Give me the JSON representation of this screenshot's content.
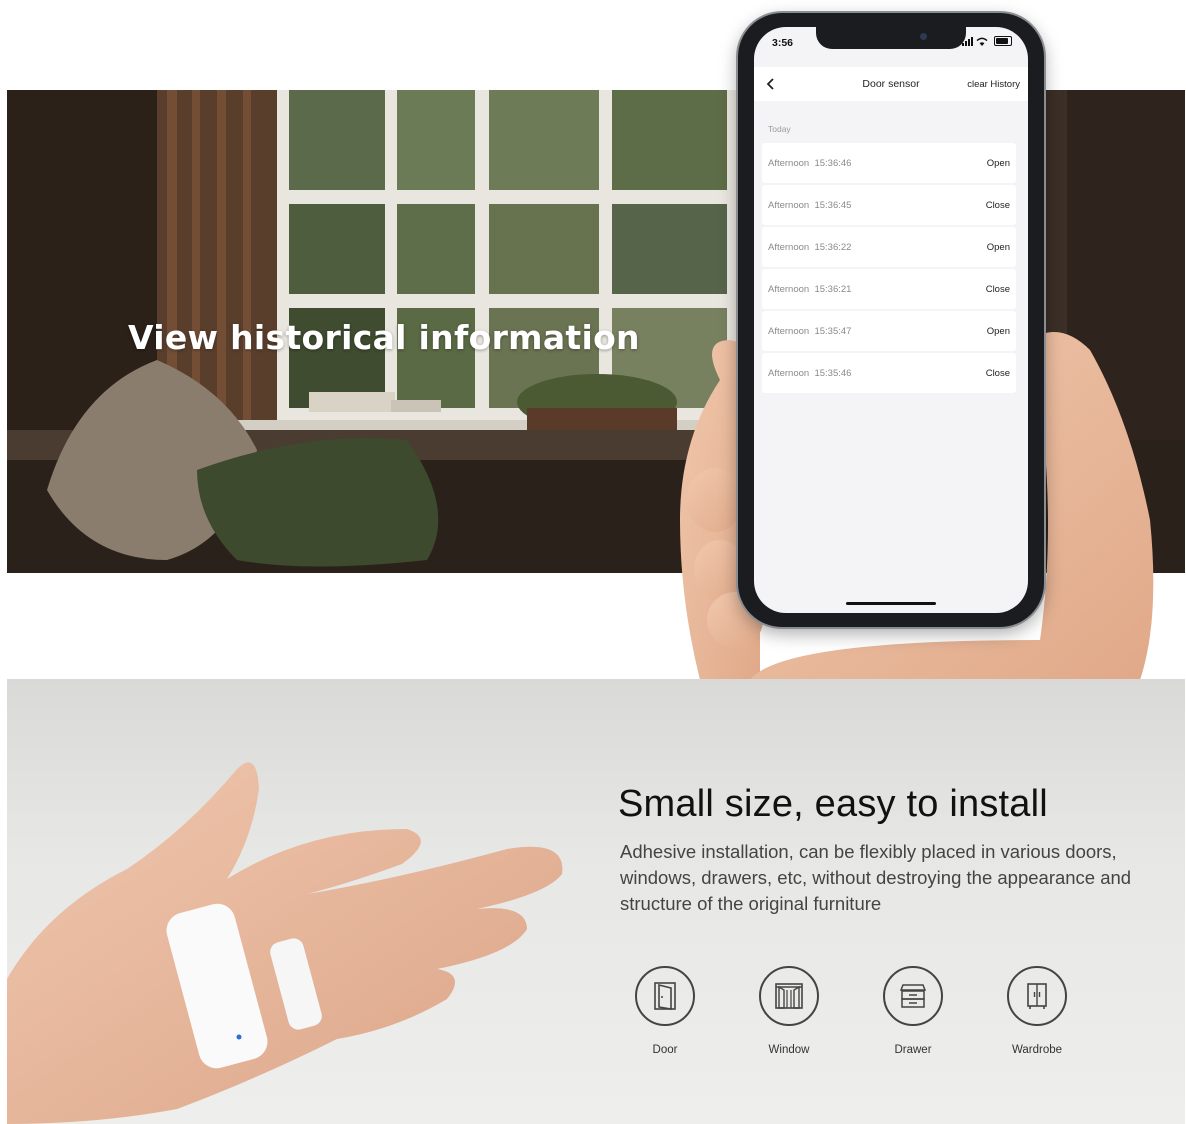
{
  "banner": {
    "title": "View historical information"
  },
  "phone": {
    "status_time": "3:56",
    "nav_title": "Door sensor",
    "nav_action": "clear History",
    "section_label": "Today",
    "history": [
      {
        "time": "Afternoon  15:36:46",
        "state": "Open"
      },
      {
        "time": "Afternoon  15:36:45",
        "state": "Close"
      },
      {
        "time": "Afternoon  15:36:22",
        "state": "Open"
      },
      {
        "time": "Afternoon  15:36:21",
        "state": "Close"
      },
      {
        "time": "Afternoon  15:35:47",
        "state": "Open"
      },
      {
        "time": "Afternoon  15:35:46",
        "state": "Close"
      }
    ]
  },
  "install": {
    "title": "Small size, easy to install",
    "description": "Adhesive installation, can be flexibly placed in various doors, windows, drawers, etc, without destroying the appearance and structure of the original furniture",
    "features": [
      {
        "label": "Door",
        "icon": "door-icon"
      },
      {
        "label": "Window",
        "icon": "window-icon"
      },
      {
        "label": "Drawer",
        "icon": "drawer-icon"
      },
      {
        "label": "Wardrobe",
        "icon": "wardrobe-icon"
      }
    ]
  },
  "colors": {
    "room_dark": "#3a2e26",
    "bottom_bg": "#e7e8e6",
    "text_dark": "#111111",
    "text_body": "#444444"
  }
}
